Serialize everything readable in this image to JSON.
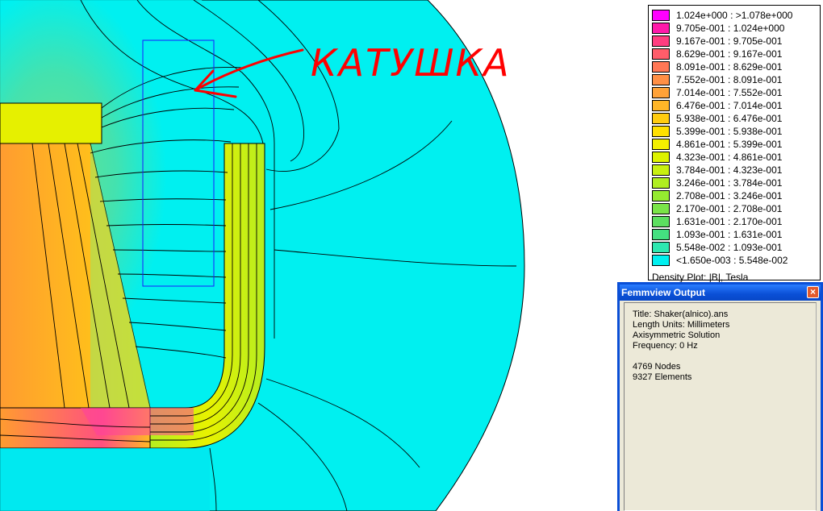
{
  "annotation": {
    "text": "КАТУШКА",
    "color": "#ff0000"
  },
  "legend": {
    "entries": [
      {
        "range": "1.024e+000 : >1.078e+000",
        "color": "#ff00ff"
      },
      {
        "range": "9.705e-001 : 1.024e+000",
        "color": "#ff1aaa"
      },
      {
        "range": "9.167e-001 : 9.705e-001",
        "color": "#ff3d80"
      },
      {
        "range": "8.629e-001 : 9.167e-001",
        "color": "#ff5d6a"
      },
      {
        "range": "8.091e-001 : 8.629e-001",
        "color": "#ff7755"
      },
      {
        "range": "7.552e-001 : 8.091e-001",
        "color": "#ff8f45"
      },
      {
        "range": "7.014e-001 : 7.552e-001",
        "color": "#ffa238"
      },
      {
        "range": "6.476e-001 : 7.014e-001",
        "color": "#ffb628"
      },
      {
        "range": "5.938e-001 : 6.476e-001",
        "color": "#ffcc10"
      },
      {
        "range": "5.399e-001 : 5.938e-001",
        "color": "#ffe000"
      },
      {
        "range": "4.861e-001 : 5.399e-001",
        "color": "#f4f000"
      },
      {
        "range": "4.323e-001 : 4.861e-001",
        "color": "#ddf200"
      },
      {
        "range": "3.784e-001 : 4.323e-001",
        "color": "#c8f010"
      },
      {
        "range": "3.246e-001 : 3.784e-001",
        "color": "#b0ee20"
      },
      {
        "range": "2.708e-001 : 3.246e-001",
        "color": "#95ea30"
      },
      {
        "range": "2.170e-001 : 2.708e-001",
        "color": "#7ae448"
      },
      {
        "range": "1.631e-001 : 2.170e-001",
        "color": "#5ce060"
      },
      {
        "range": "1.093e-001 : 1.631e-001",
        "color": "#44e080"
      },
      {
        "range": "5.548e-002 : 1.093e-001",
        "color": "#2ee8b0"
      },
      {
        "range": "<1.650e-003 : 5.548e-002",
        "color": "#00f0f0"
      }
    ],
    "caption": "Density Plot: |B|, Tesla"
  },
  "output_window": {
    "title": "Femmview Output",
    "close_glyph": "×",
    "lines": [
      "Title: Shaker(alnico).ans",
      "Length Units: Millimeters",
      "Axisymmetric Solution",
      "Frequency: 0 Hz",
      "",
      "4769 Nodes",
      "9327 Elements"
    ]
  }
}
